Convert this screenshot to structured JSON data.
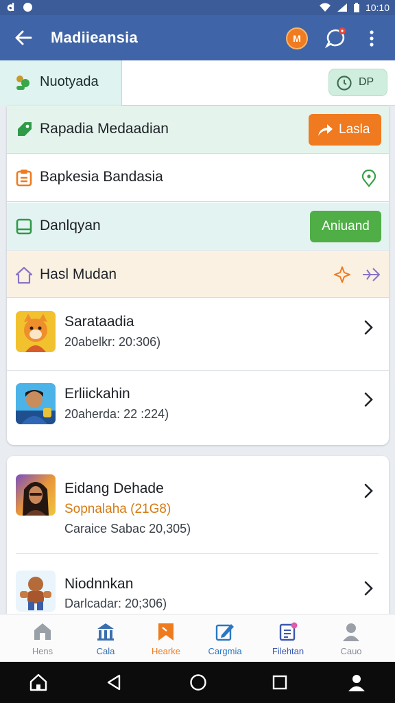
{
  "status_bar": {
    "time": "10:10"
  },
  "app_bar": {
    "title": "Madiieansia",
    "avatar_initials": "M"
  },
  "tabs": {
    "active_label": "Nuotyada",
    "pill_label": "DP"
  },
  "rows": [
    {
      "label": "Rapadia Medaadian",
      "button": "Lasla"
    },
    {
      "label": "Bapkesia Bandasia"
    },
    {
      "label": "Danlqyan",
      "button": "Aniuand"
    },
    {
      "label": "Hasl Mudan"
    }
  ],
  "contacts": [
    {
      "name": "Sarataadia",
      "sub": "20abelkr: 20:306)"
    },
    {
      "name": "Erliickahin",
      "sub": "20aherda: 22 :224)"
    }
  ],
  "contacts2": [
    {
      "name": "Eidang Dehade",
      "highlight": "Sopnalaha (21G8)",
      "sub": "Caraice Sabac 20,305)"
    },
    {
      "name": "Niodnnkan",
      "sub": "Darlcadar: 20;306)"
    }
  ],
  "bottom_nav": [
    {
      "label": "Hens",
      "color": "#8a8f96"
    },
    {
      "label": "Cala",
      "color": "#3a6fae"
    },
    {
      "label": "Hearke",
      "color": "#ee7c1e"
    },
    {
      "label": "Cargmia",
      "color": "#2b78c2"
    },
    {
      "label": "Filehtan",
      "color": "#3a58b0"
    },
    {
      "label": "Cauo",
      "color": "#8a8f96"
    }
  ],
  "colors": {
    "appbar": "#3f65a8",
    "orange": "#ef7a1f",
    "green": "#4fae46"
  }
}
